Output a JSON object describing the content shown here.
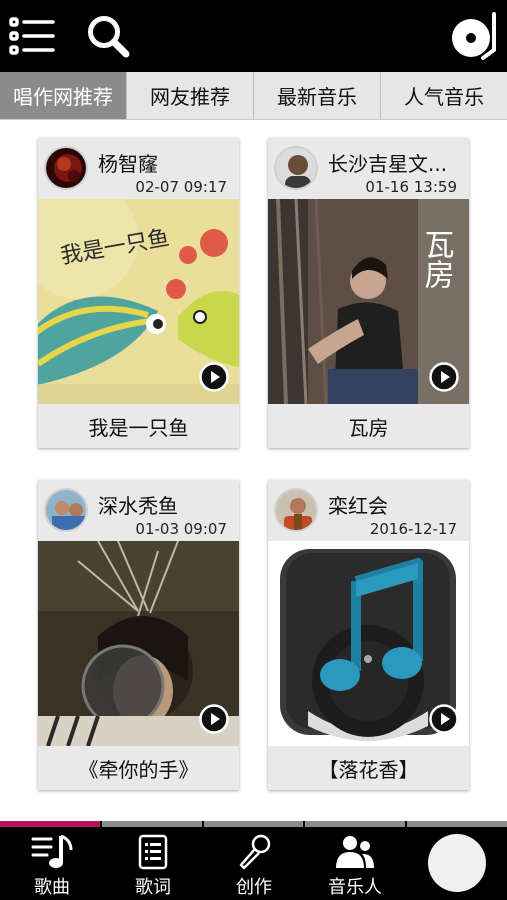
{
  "header": {
    "menu_icon": "list-menu-icon",
    "search_icon": "search-icon",
    "record_icon": "vinyl-record-icon"
  },
  "tabs": [
    {
      "label": "唱作网推荐",
      "active": true
    },
    {
      "label": "网友推荐",
      "active": false
    },
    {
      "label": "最新音乐",
      "active": false
    },
    {
      "label": "人气音乐",
      "active": false
    }
  ],
  "cards": [
    {
      "author": "杨智窿",
      "time": "02-07 09:17",
      "title": "我是一只鱼",
      "cover_text": "我是一只鱼"
    },
    {
      "author": "长沙吉星文...",
      "time": "01-16 13:59",
      "title": "瓦房",
      "cover_text": "瓦房"
    },
    {
      "author": "深水秃鱼",
      "time": "01-03 09:07",
      "title": "《牵你的手》"
    },
    {
      "author": "栾红会",
      "time": "2016-12-17",
      "title": "【落花香】"
    }
  ],
  "bottom_nav": [
    {
      "label": "歌曲",
      "icon": "music-note-list-icon"
    },
    {
      "label": "歌词",
      "icon": "lyrics-document-icon"
    },
    {
      "label": "创作",
      "icon": "microphone-icon"
    },
    {
      "label": "音乐人",
      "icon": "musicians-people-icon"
    }
  ],
  "progress_strip": {
    "segments": 5,
    "active_index": 0
  },
  "colors": {
    "accent": "#b5125b",
    "bar": "#000000",
    "tab_active": "#8b8b8b"
  }
}
